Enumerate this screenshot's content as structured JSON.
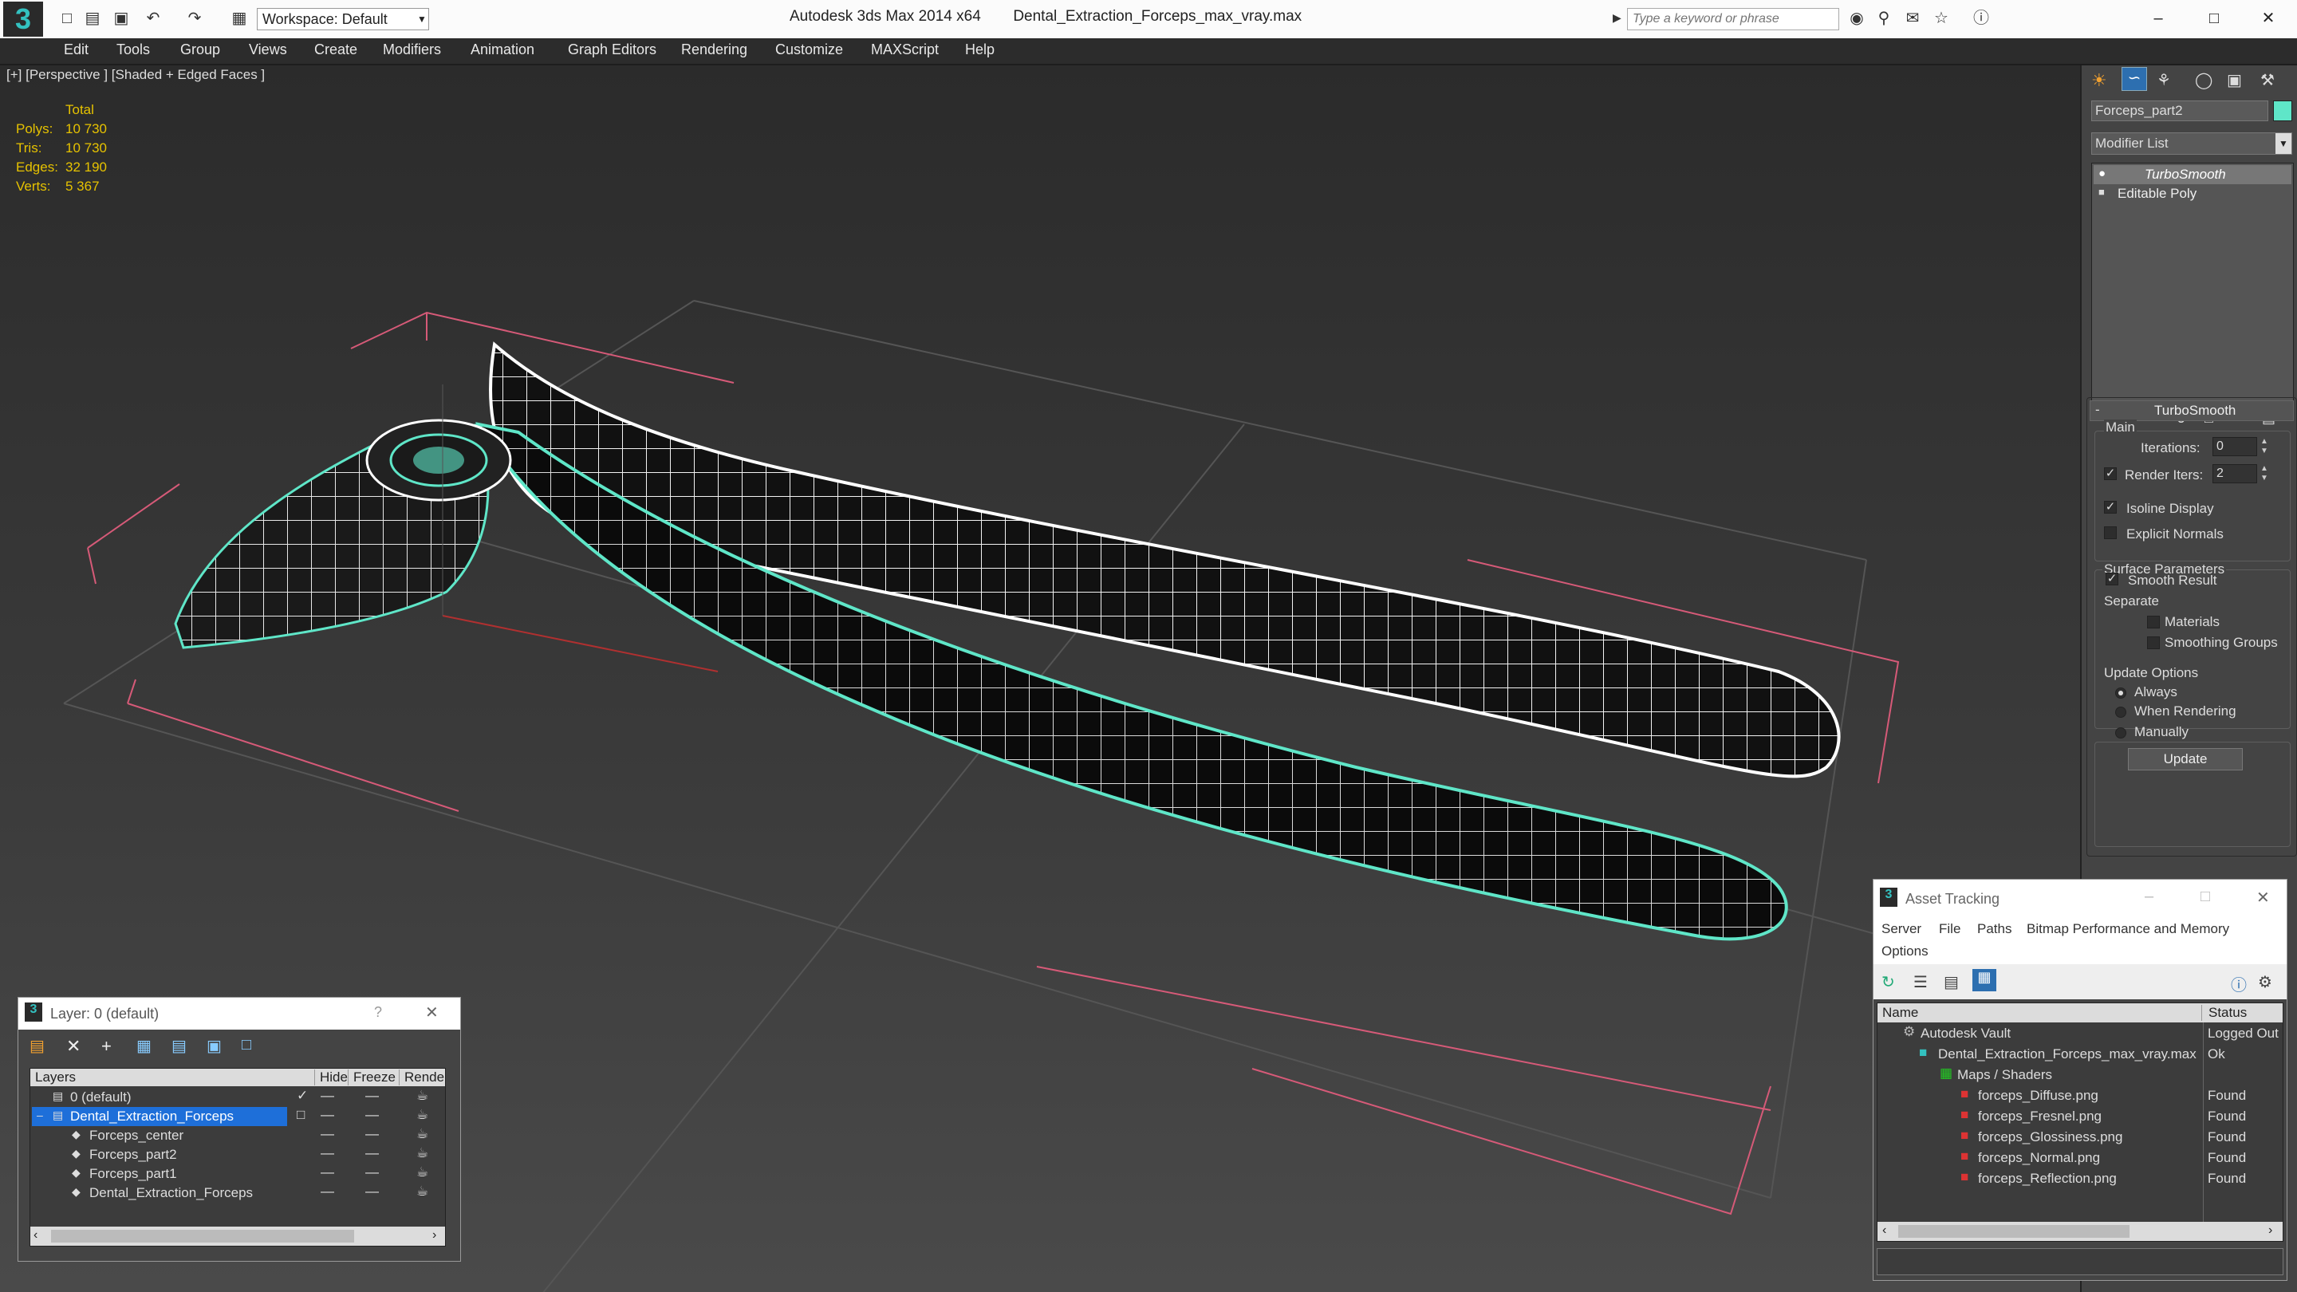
{
  "app": {
    "name": "Autodesk 3ds Max  2014 x64",
    "file": "Dental_Extraction_Forceps_max_vray.max",
    "workspace": "Workspace: Default",
    "search_placeholder": "Type a keyword or phrase"
  },
  "menu": [
    "Edit",
    "Tools",
    "Group",
    "Views",
    "Create",
    "Modifiers",
    "Animation",
    "Graph Editors",
    "Rendering",
    "Customize",
    "MAXScript",
    "Help"
  ],
  "viewport": {
    "label": "[+] [Perspective ] [Shaded + Edged Faces ]",
    "stats": {
      "header": "Total",
      "rows": [
        {
          "label": "Polys:",
          "value": "10 730"
        },
        {
          "label": "Tris:",
          "value": "10 730"
        },
        {
          "label": "Edges:",
          "value": "32 190"
        },
        {
          "label": "Verts:",
          "value": "5 367"
        }
      ]
    }
  },
  "command_panel": {
    "object_name": "Forceps_part2",
    "modifier_list": "Modifier List",
    "stack": [
      "TurboSmooth",
      "Editable Poly"
    ],
    "rollout_title": "TurboSmooth",
    "main": "Main",
    "iterations_label": "Iterations:",
    "iterations_value": "0",
    "render_iters_label": "Render Iters:",
    "render_iters_value": "2",
    "isoline": "Isoline Display",
    "explicit": "Explicit Normals",
    "surface": "Surface Parameters",
    "smooth_result": "Smooth Result",
    "separate": "Separate",
    "materials": "Materials",
    "smoothing_groups": "Smoothing Groups",
    "update_options": "Update Options",
    "always": "Always",
    "when_rendering": "When Rendering",
    "manually": "Manually",
    "update_button": "Update",
    "accent": "#5fe6c8"
  },
  "layer_dialog": {
    "title": "Layer: 0 (default)",
    "help": "?",
    "columns": [
      "Layers",
      "Hide",
      "Freeze",
      "Render"
    ],
    "rows": [
      "0 (default)",
      "Dental_Extraction_Forceps",
      "Forceps_center",
      "Forceps_part2",
      "Forceps_part1",
      "Dental_Extraction_Forceps"
    ]
  },
  "asset_tracking": {
    "title": "Asset Tracking",
    "menu": [
      "Server",
      "File",
      "Paths",
      "Bitmap Performance and Memory",
      "Options"
    ],
    "columns": [
      "Name",
      "Status"
    ],
    "rows": [
      {
        "name": "Autodesk Vault",
        "status": "Logged Out"
      },
      {
        "name": "Dental_Extraction_Forceps_max_vray.max",
        "status": "Ok"
      },
      {
        "name": "Maps / Shaders",
        "status": ""
      },
      {
        "name": "forceps_Diffuse.png",
        "status": "Found"
      },
      {
        "name": "forceps_Fresnel.png",
        "status": "Found"
      },
      {
        "name": "forceps_Glossiness.png",
        "status": "Found"
      },
      {
        "name": "forceps_Normal.png",
        "status": "Found"
      },
      {
        "name": "forceps_Reflection.png",
        "status": "Found"
      }
    ]
  }
}
